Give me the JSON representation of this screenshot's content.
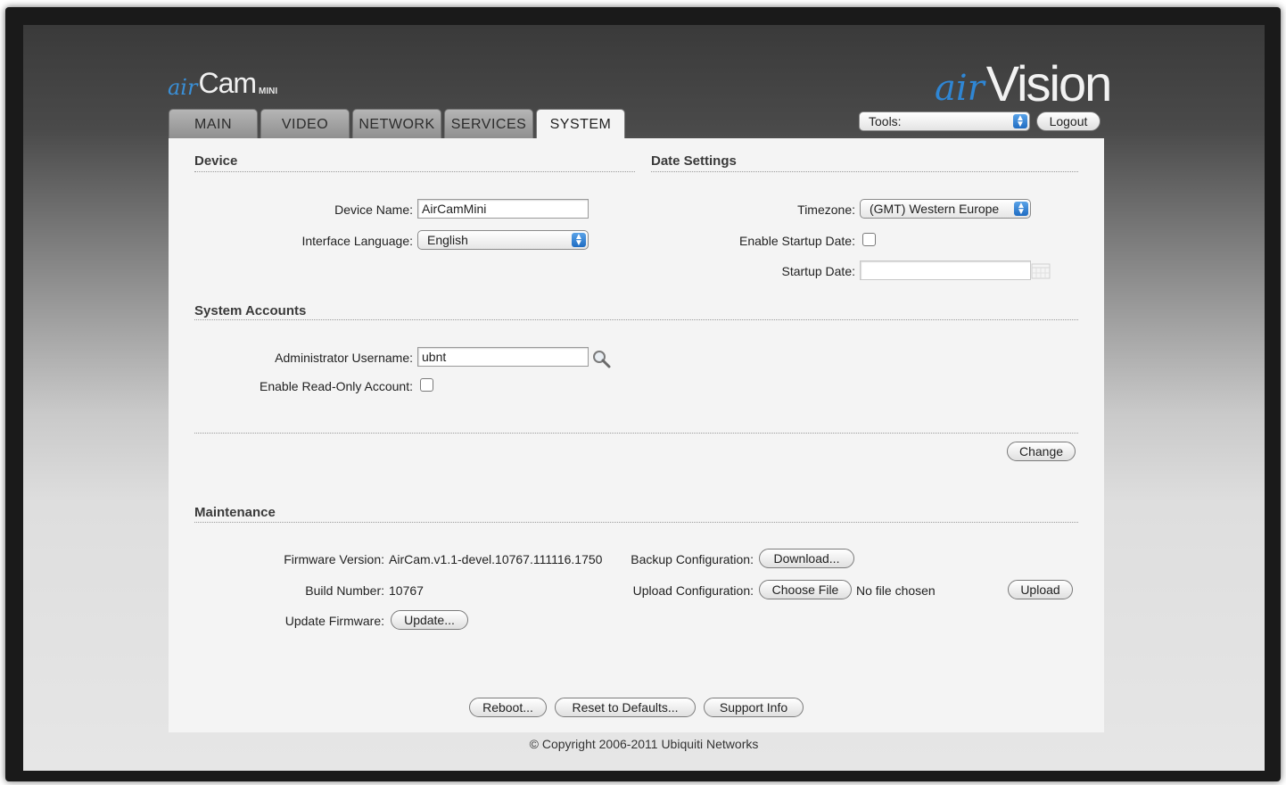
{
  "logo_left": {
    "air": "air",
    "cam": "Cam",
    "mini": "MINI"
  },
  "logo_right": {
    "air": "air",
    "vision": "Vision"
  },
  "tabs": [
    "MAIN",
    "VIDEO",
    "NETWORK",
    "SERVICES",
    "SYSTEM"
  ],
  "active_tab": "SYSTEM",
  "header": {
    "tools_label": "Tools:",
    "logout_label": "Logout"
  },
  "device": {
    "title": "Device",
    "device_name_label": "Device Name:",
    "device_name_value": "AirCamMini",
    "interface_language_label": "Interface Language:",
    "interface_language_value": "English"
  },
  "date_settings": {
    "title": "Date Settings",
    "timezone_label": "Timezone:",
    "timezone_value": "(GMT) Western Europe",
    "enable_startup_date_label": "Enable Startup Date:",
    "startup_date_label": "Startup Date:",
    "startup_date_value": ""
  },
  "system_accounts": {
    "title": "System Accounts",
    "admin_username_label": "Administrator Username:",
    "admin_username_value": "ubnt",
    "readonly_label": "Enable Read-Only Account:"
  },
  "change_button": "Change",
  "maintenance": {
    "title": "Maintenance",
    "firmware_version_label": "Firmware Version:",
    "firmware_version_value": "AirCam.v1.1-devel.10767.111116.1750",
    "build_number_label": "Build Number:",
    "build_number_value": "10767",
    "update_firmware_label": "Update Firmware:",
    "update_button": "Update...",
    "backup_config_label": "Backup Configuration:",
    "download_button": "Download...",
    "upload_config_label": "Upload Configuration:",
    "choose_file_button": "Choose File",
    "no_file_text": "No file chosen",
    "upload_button": "Upload"
  },
  "bottom_buttons": {
    "reboot": "Reboot...",
    "reset": "Reset to Defaults...",
    "support": "Support Info"
  },
  "footer": "© Copyright 2006-2011 Ubiquiti Networks"
}
